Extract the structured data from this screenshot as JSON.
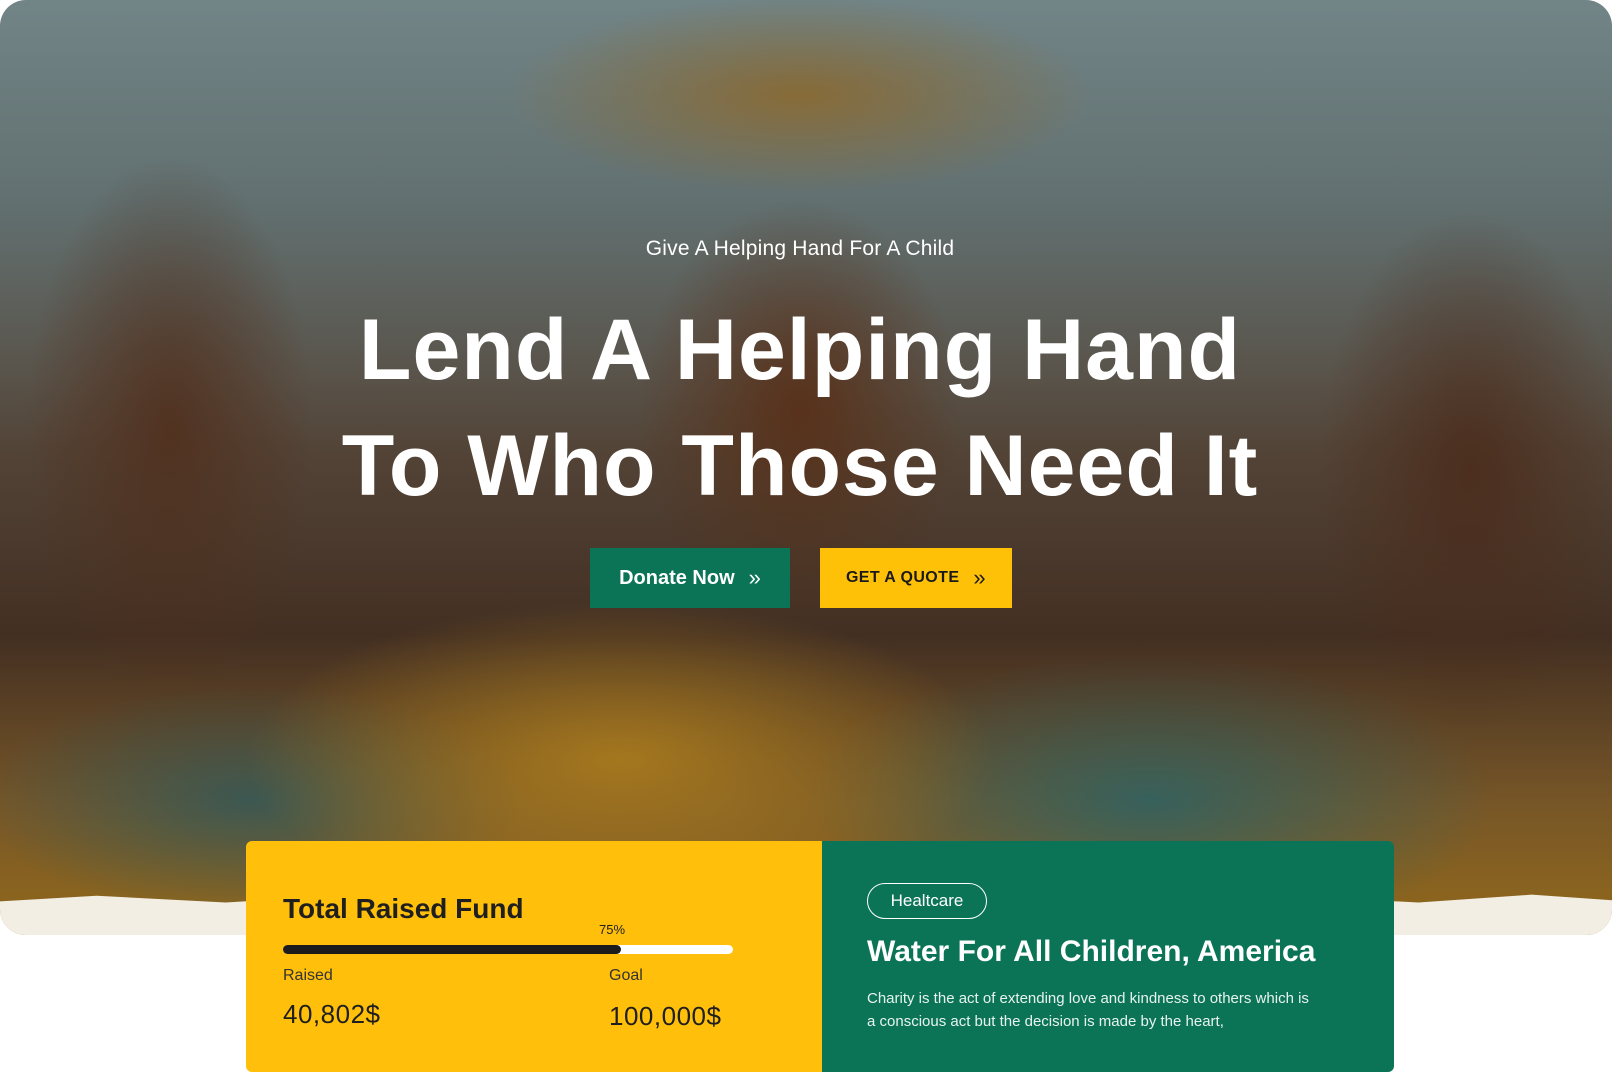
{
  "hero": {
    "eyebrow": "Give A Helping Hand For A Child",
    "headline_line1": "Lend A Helping Hand",
    "headline_line2": "To Who Those Need It",
    "donate_label": "Donate Now",
    "quote_label": "GET A QUOTE",
    "chevron": "»"
  },
  "fund": {
    "title": "Total Raised Fund",
    "percent_label": "75%",
    "progress": 0.75,
    "raised_label": "Raised",
    "raised_value": "40,802$",
    "goal_label": "Goal",
    "goal_value": "100,000$"
  },
  "cause": {
    "tag": "Healtcare",
    "title": "Water For All Children, America",
    "description": "Charity is the act of extending love and kindness to others which is a conscious act but the decision is made by the heart,"
  },
  "colors": {
    "primary_green": "#0b7457",
    "accent_yellow": "#ffc107",
    "white": "#ffffff"
  }
}
